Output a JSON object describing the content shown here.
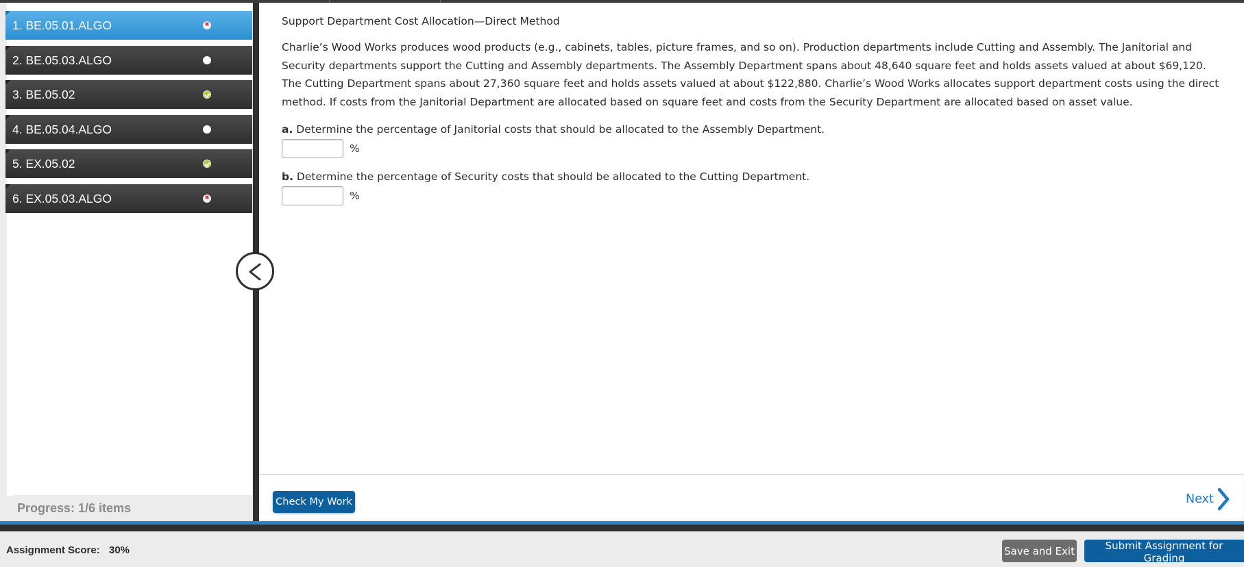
{
  "sidebar": {
    "items": [
      {
        "label": "1. BE.05.01.ALGO",
        "status": "incorrect",
        "active": true
      },
      {
        "label": "2. BE.05.03.ALGO",
        "status": "unanswered",
        "active": false
      },
      {
        "label": "3. BE.05.02",
        "status": "correct",
        "active": false
      },
      {
        "label": "4. BE.05.04.ALGO",
        "status": "unanswered",
        "active": false
      },
      {
        "label": "5. EX.05.02",
        "status": "correct",
        "active": false
      },
      {
        "label": "6. EX.05.03.ALGO",
        "status": "incorrect",
        "active": false
      }
    ],
    "progress": "Progress:  1/6 items"
  },
  "question": {
    "title": "Support Department Cost Allocation—Direct Method",
    "body": "Charlie’s Wood Works produces wood products (e.g., cabinets, tables, picture frames, and so on). Production departments include Cutting and Assembly. The Janitorial and Security departments support the Cutting and Assembly departments. The Assembly Department spans about 48,640 square feet and holds assets valued at about $69,120. The Cutting Department spans about 27,360 square feet and holds assets valued at about $122,880. Charlie’s Wood Works allocates support department costs using the direct method. If costs from the Janitorial Department are allocated based on square feet and costs from the Security Department are allocated based on asset value.",
    "part_a": {
      "letter": "a.",
      "text": " Determine the percentage of Janitorial costs that should be allocated to the Assembly Department.",
      "value": "",
      "unit": "%"
    },
    "part_b": {
      "letter": "b.",
      "text": " Determine the percentage of Security costs that should be allocated to the Cutting Department.",
      "value": "",
      "unit": "%"
    }
  },
  "footer": {
    "check_label": "Check My Work",
    "next_label": "Next"
  },
  "bottom": {
    "score_label": "Assignment Score:",
    "score_value": "30%",
    "save_exit_label": "Save and Exit",
    "submit_label": "Submit Assignment for Grading"
  },
  "colors": {
    "active_item": "#2b8fd1",
    "primary_button": "#0e5f9e",
    "correct": "#a7d23c",
    "incorrect": "#d0334a"
  }
}
